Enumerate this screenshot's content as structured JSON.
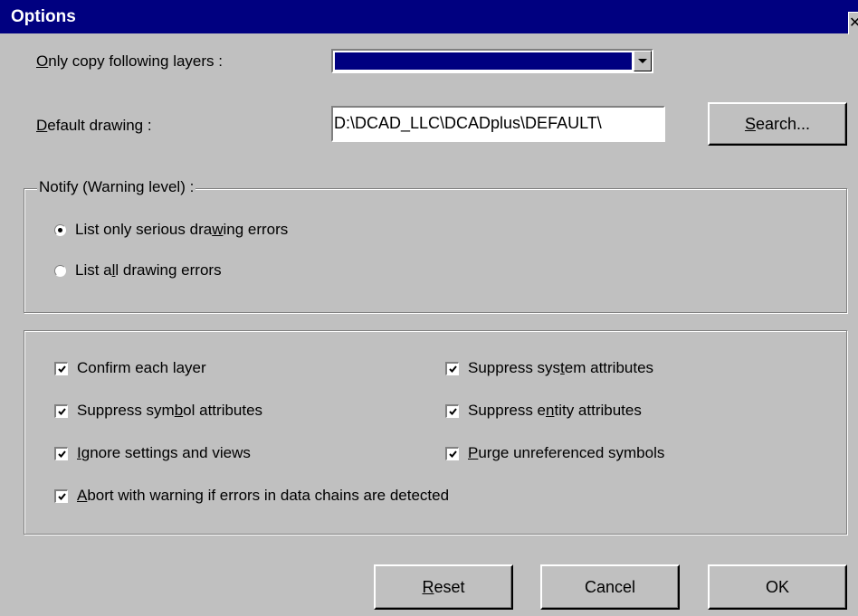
{
  "window": {
    "title": "Options",
    "close_glyph": "✕"
  },
  "layers": {
    "label_u": "O",
    "label_rest": "nly copy following layers :",
    "selected_value": ""
  },
  "default_drawing": {
    "label_u": "D",
    "label_rest": "efault drawing :",
    "value": "D:\\DCAD_LLC\\DCADplus\\DEFAULT\\",
    "search_u": "S",
    "search_rest": "earch..."
  },
  "notify": {
    "legend": "Notify (Warning level) :",
    "options": [
      {
        "pre": "List only serious dra",
        "u": "w",
        "post": "ing errors",
        "checked": true
      },
      {
        "pre": "List a",
        "u": "l",
        "post": "l drawing errors",
        "checked": false
      }
    ]
  },
  "checks": [
    {
      "pre": "Confirm each layer",
      "u": "",
      "post": "",
      "checked": true
    },
    {
      "pre": "Suppress sys",
      "u": "t",
      "post": "em attributes",
      "checked": true
    },
    {
      "pre": "Suppress sym",
      "u": "b",
      "post": "ol attributes",
      "checked": true
    },
    {
      "pre": "Suppress e",
      "u": "n",
      "post": "tity attributes",
      "checked": true
    },
    {
      "pre": "",
      "u": "I",
      "post": "gnore settings and views",
      "checked": true
    },
    {
      "pre": "",
      "u": "P",
      "post": "urge unreferenced symbols",
      "checked": true
    },
    {
      "pre": "",
      "u": "A",
      "post": "bort with warning if errors in data chains are detected",
      "checked": true
    }
  ],
  "buttons": {
    "reset_u": "R",
    "reset_rest": "eset",
    "cancel": "Cancel",
    "ok": "OK"
  },
  "colors": {
    "titlebar": "#000080",
    "face": "#c0c0c0",
    "selection": "#000080"
  },
  "icons": {
    "checkbox": "check-mark-icon",
    "dropdown": "chevron-down-icon",
    "close": "close-icon"
  }
}
